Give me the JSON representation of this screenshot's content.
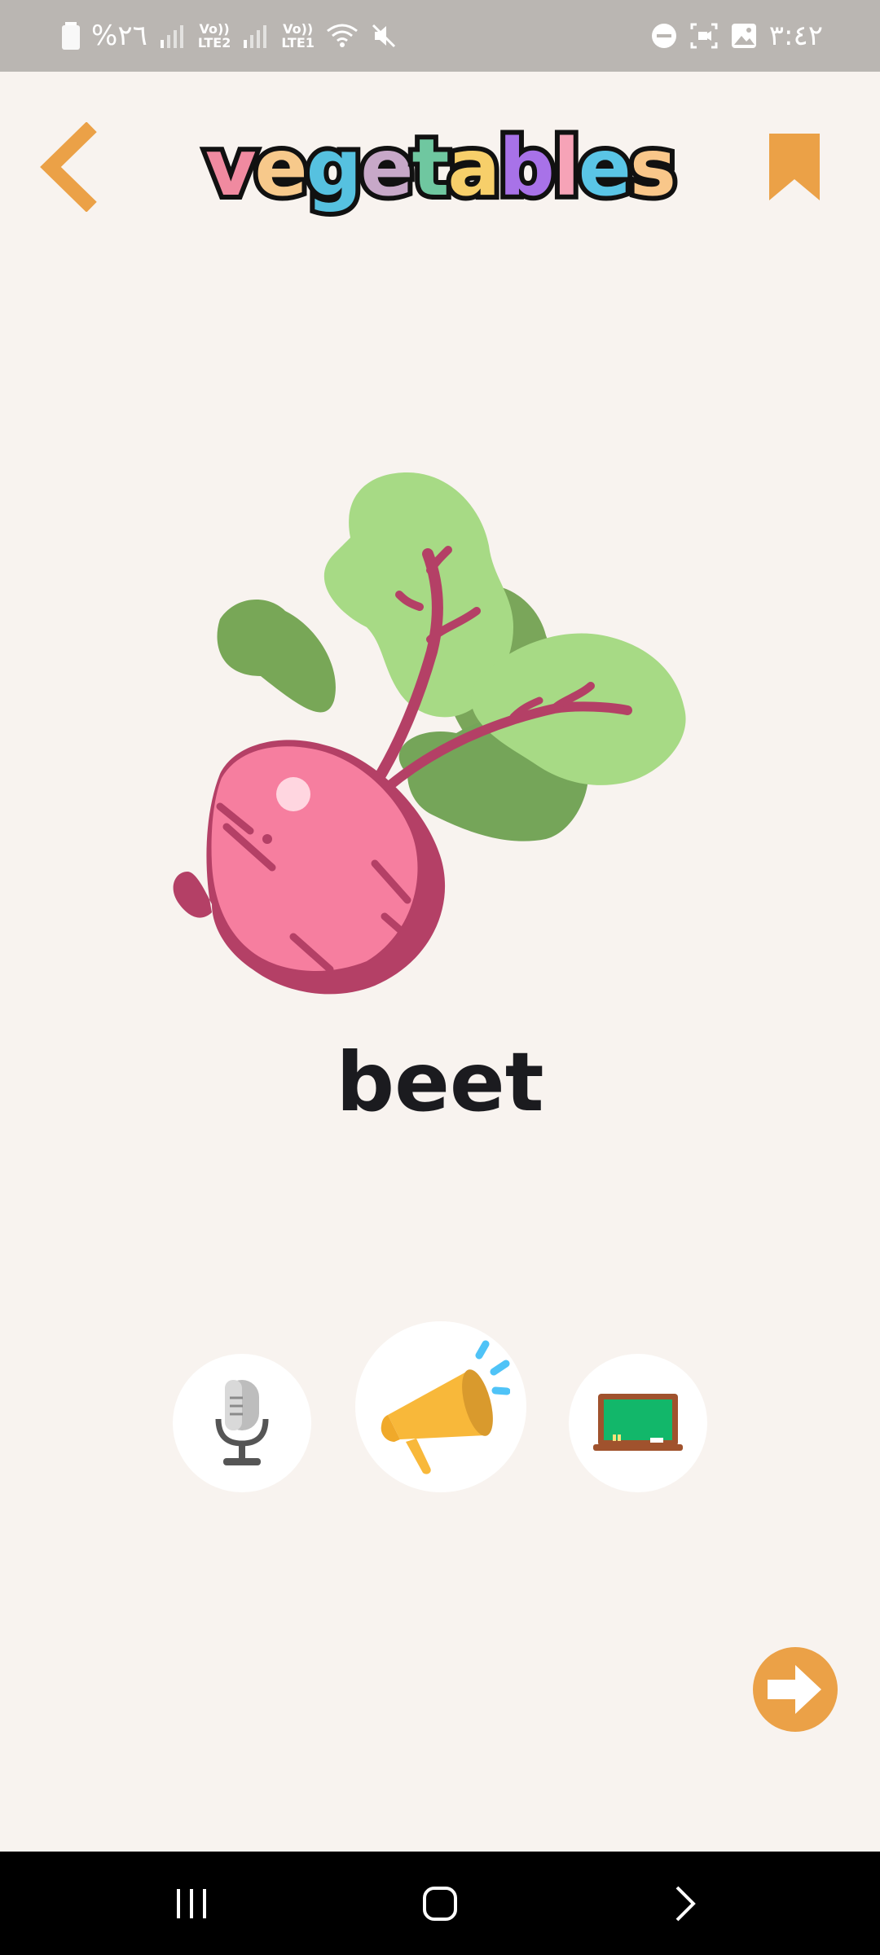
{
  "status_bar": {
    "battery": "%٢٦",
    "net2": [
      "Vo))",
      "LTE2"
    ],
    "net1": [
      "Vo))",
      "LTE1"
    ],
    "time": "٣:٤٢"
  },
  "header": {
    "title_letters": [
      {
        "char": "v",
        "color": "#f08aa0"
      },
      {
        "char": "e",
        "color": "#f7c98b"
      },
      {
        "char": "g",
        "color": "#56c1e0"
      },
      {
        "char": "e",
        "color": "#c7a8c8"
      },
      {
        "char": "t",
        "color": "#6fc7a0"
      },
      {
        "char": "a",
        "color": "#f7cf6a"
      },
      {
        "char": "b",
        "color": "#a872e8"
      },
      {
        "char": "l",
        "color": "#f6a3b7"
      },
      {
        "char": "e",
        "color": "#5ac5e6"
      },
      {
        "char": "s",
        "color": "#f9c78a"
      }
    ],
    "back_icon": "chevron-left-icon",
    "bookmark_icon": "bookmark-icon"
  },
  "card": {
    "illustration": "beet-illustration",
    "word": "beet"
  },
  "actions": {
    "record_icon": "microphone-icon",
    "speak_icon": "megaphone-icon",
    "board_icon": "chalkboard-icon"
  },
  "next_icon": "arrow-right-icon",
  "colors": {
    "accent": "#eba147",
    "background": "#f8f3ef",
    "status_bar": "#bab6b2"
  }
}
